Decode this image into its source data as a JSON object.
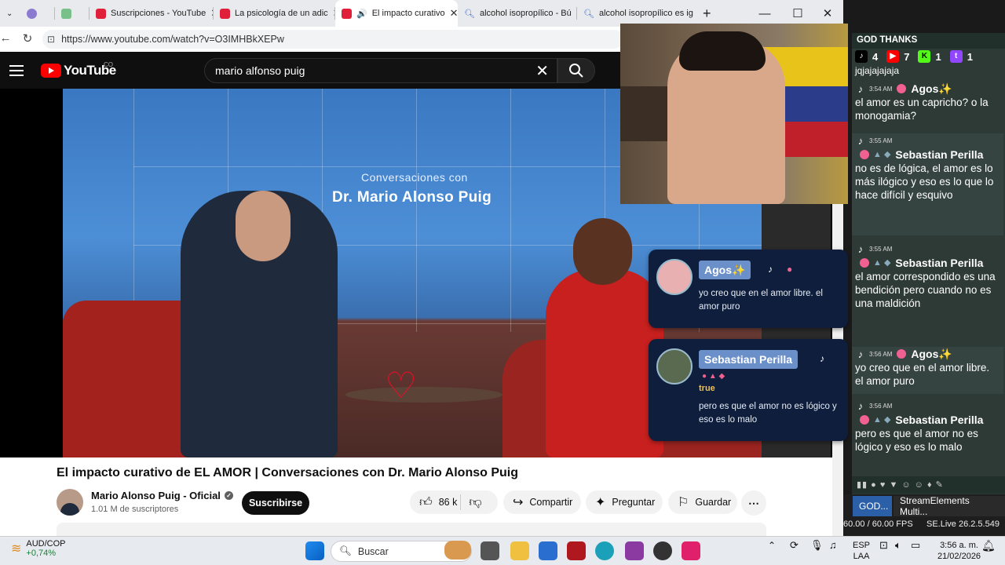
{
  "browser": {
    "tabs": [
      {
        "label": "",
        "fav": "#8a7ad0"
      },
      {
        "label": "",
        "fav": "#7ac08a"
      },
      {
        "label": "Suscripciones - YouTube",
        "fav": "#e0203a"
      },
      {
        "label": "La psicología de un adic",
        "fav": "#e0203a"
      },
      {
        "label": "El impacto curativo",
        "fav": "#e0203a"
      },
      {
        "label": "alcohol isopropílico - Bú",
        "fav": "#3a6fd0"
      },
      {
        "label": "alcohol isopropílico es ig",
        "fav": "#3a6fd0"
      }
    ],
    "url": "https://www.youtube.com/watch?v=O3IMHBkXEPw"
  },
  "youtube": {
    "logo_text": "YouTube",
    "country": "CO",
    "search_value": "mario alfonso puig",
    "video_overlay_line1": "Conversaciones con",
    "video_overlay_line2": "Dr. Mario Alonso Puig",
    "video_title": "El impacto curativo de EL AMOR | Conversaciones con Dr. Mario Alonso Puig",
    "channel_name": "Mario Alonso Puig - Oficial",
    "subscribers": "1.01 M de suscriptores",
    "subscribe_label": "Suscribirse",
    "likes": "86 k",
    "share_label": "Compartir",
    "ask_label": "Preguntar",
    "save_label": "Guardar"
  },
  "overlay_chat": [
    {
      "user": "Agos✨",
      "message": "yo creo que en el amor libre. el amor puro"
    },
    {
      "user": "Sebastian Perilla",
      "tag": "true",
      "message": "pero es que el amor no es lógico y eso es lo malo"
    }
  ],
  "chat_panel": {
    "title": "GOD THANKS",
    "counts": {
      "tiktok": "4",
      "youtube": "7",
      "kick": "1",
      "twitch": "1"
    },
    "partial_line": "jqjajajajaja",
    "messages": [
      {
        "time": "3:54 AM",
        "user": "Agos✨",
        "text": "el amor es un capricho? o la monogamia?"
      },
      {
        "time": "3:55 AM",
        "user": "Sebastian Perilla",
        "text": "no es de lógica, el amor es lo más ilógico y eso es lo que lo hace difícil y esquivo"
      },
      {
        "time": "3:55 AM",
        "user": "Sebastian Perilla",
        "text": "el amor correspondido es una bendición pero cuando no es una maldición"
      },
      {
        "time": "3:56 AM",
        "user": "Agos✨",
        "text": "yo creo que en el amor libre. el amor puro"
      },
      {
        "time": "3:56 AM",
        "user": "Sebastian Perilla",
        "text": "pero es que el amor no es lógico y eso es lo malo"
      }
    ],
    "obs_tab1": "GOD...",
    "obs_tab2": "StreamElements Multi...",
    "fps": "60.00 / 60.00 FPS",
    "version": "SE.Live 26.2.5.549"
  },
  "taskbar": {
    "ticker_symbol": "AUD/COP",
    "ticker_change": "+0,74%",
    "search_placeholder": "Buscar",
    "lang1": "ESP",
    "lang2": "LAA",
    "time": "3:56 a. m.",
    "date": "21/02/2026"
  }
}
